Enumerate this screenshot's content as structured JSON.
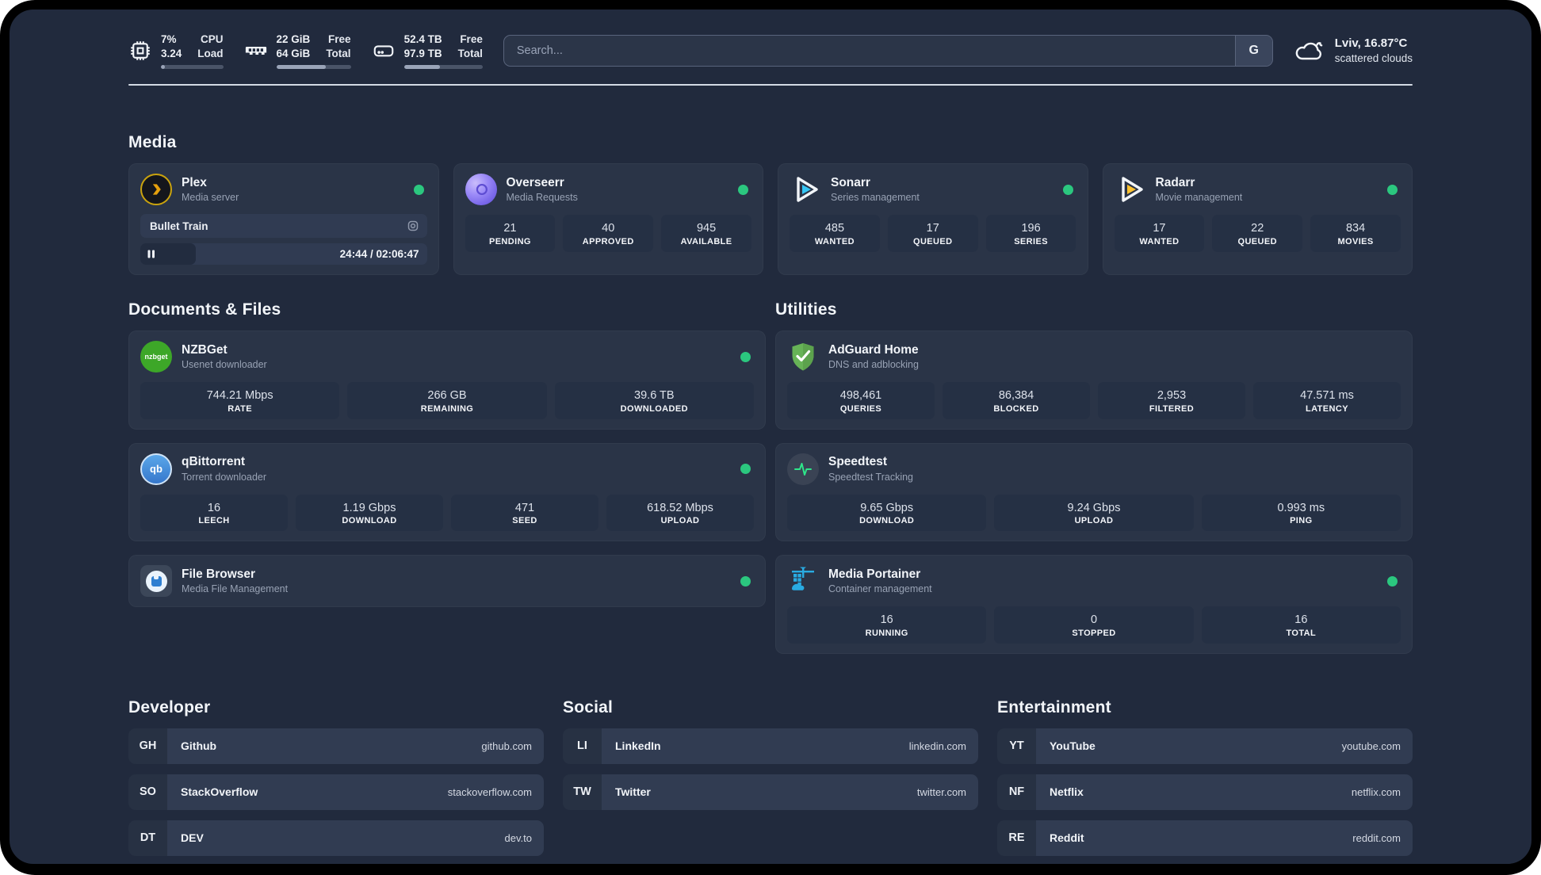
{
  "topbar": {
    "metrics": [
      {
        "icon": "cpu-icon",
        "value_top": "7%",
        "value_bottom": "3.24",
        "label_top": "CPU",
        "label_bottom": "Load",
        "progress": 7
      },
      {
        "icon": "ram-icon",
        "value_top": "22 GiB",
        "value_bottom": "64 GiB",
        "label_top": "Free",
        "label_bottom": "Total",
        "progress": 66
      },
      {
        "icon": "disk-icon",
        "value_top": "52.4 TB",
        "value_bottom": "97.9 TB",
        "label_top": "Free",
        "label_bottom": "Total",
        "progress": 46
      }
    ],
    "search": {
      "placeholder": "Search...",
      "button_label": "G"
    },
    "weather": {
      "location_temp": "Lviv, 16.87°C",
      "condition": "scattered clouds"
    }
  },
  "media": {
    "title": "Media",
    "apps": [
      {
        "name": "Plex",
        "desc": "Media server",
        "now_playing": {
          "title": "Bullet Train",
          "time": "24:44 / 02:06:47",
          "progress": 19.5
        }
      },
      {
        "name": "Overseerr",
        "desc": "Media Requests",
        "stats": [
          {
            "value": "21",
            "label": "PENDING"
          },
          {
            "value": "40",
            "label": "APPROVED"
          },
          {
            "value": "945",
            "label": "AVAILABLE"
          }
        ]
      },
      {
        "name": "Sonarr",
        "desc": "Series management",
        "stats": [
          {
            "value": "485",
            "label": "WANTED"
          },
          {
            "value": "17",
            "label": "QUEUED"
          },
          {
            "value": "196",
            "label": "SERIES"
          }
        ]
      },
      {
        "name": "Radarr",
        "desc": "Movie management",
        "stats": [
          {
            "value": "17",
            "label": "WANTED"
          },
          {
            "value": "22",
            "label": "QUEUED"
          },
          {
            "value": "834",
            "label": "MOVIES"
          }
        ]
      }
    ]
  },
  "documents": {
    "title": "Documents & Files",
    "apps": [
      {
        "name": "NZBGet",
        "desc": "Usenet downloader",
        "stats": [
          {
            "value": "744.21 Mbps",
            "label": "RATE"
          },
          {
            "value": "266 GB",
            "label": "REMAINING"
          },
          {
            "value": "39.6 TB",
            "label": "DOWNLOADED"
          }
        ]
      },
      {
        "name": "qBittorrent",
        "desc": "Torrent downloader",
        "stats": [
          {
            "value": "16",
            "label": "LEECH"
          },
          {
            "value": "1.19 Gbps",
            "label": "DOWNLOAD"
          },
          {
            "value": "471",
            "label": "SEED"
          },
          {
            "value": "618.52 Mbps",
            "label": "UPLOAD"
          }
        ]
      },
      {
        "name": "File Browser",
        "desc": "Media File Management"
      }
    ]
  },
  "utilities": {
    "title": "Utilities",
    "apps": [
      {
        "name": "AdGuard Home",
        "desc": "DNS and adblocking",
        "stats": [
          {
            "value": "498,461",
            "label": "QUERIES"
          },
          {
            "value": "86,384",
            "label": "BLOCKED"
          },
          {
            "value": "2,953",
            "label": "FILTERED"
          },
          {
            "value": "47.571 ms",
            "label": "LATENCY"
          }
        ]
      },
      {
        "name": "Speedtest",
        "desc": "Speedtest Tracking",
        "stats": [
          {
            "value": "9.65 Gbps",
            "label": "DOWNLOAD"
          },
          {
            "value": "9.24 Gbps",
            "label": "UPLOAD"
          },
          {
            "value": "0.993 ms",
            "label": "PING"
          }
        ]
      },
      {
        "name": "Media Portainer",
        "desc": "Container management",
        "stats": [
          {
            "value": "16",
            "label": "RUNNING"
          },
          {
            "value": "0",
            "label": "STOPPED"
          },
          {
            "value": "16",
            "label": "TOTAL"
          }
        ]
      }
    ]
  },
  "links": [
    {
      "title": "Developer",
      "items": [
        {
          "abbr": "GH",
          "name": "Github",
          "url": "github.com"
        },
        {
          "abbr": "SO",
          "name": "StackOverflow",
          "url": "stackoverflow.com"
        },
        {
          "abbr": "DT",
          "name": "DEV",
          "url": "dev.to"
        }
      ]
    },
    {
      "title": "Social",
      "items": [
        {
          "abbr": "LI",
          "name": "LinkedIn",
          "url": "linkedin.com"
        },
        {
          "abbr": "TW",
          "name": "Twitter",
          "url": "twitter.com"
        }
      ]
    },
    {
      "title": "Entertainment",
      "items": [
        {
          "abbr": "YT",
          "name": "YouTube",
          "url": "youtube.com"
        },
        {
          "abbr": "NF",
          "name": "Netflix",
          "url": "netflix.com"
        },
        {
          "abbr": "RE",
          "name": "Reddit",
          "url": "reddit.com"
        }
      ]
    }
  ],
  "icon_labels": {
    "nzbget": "nzbget",
    "qbittorrent": "qb"
  },
  "colors": {
    "status_online": "#2bc77f",
    "panel_bg": "#212a3d",
    "card_bg": "#2a3447",
    "accent_sonarr": "#35c5f4",
    "accent_radarr": "#ffc230",
    "accent_plex": "#e5a00d"
  }
}
